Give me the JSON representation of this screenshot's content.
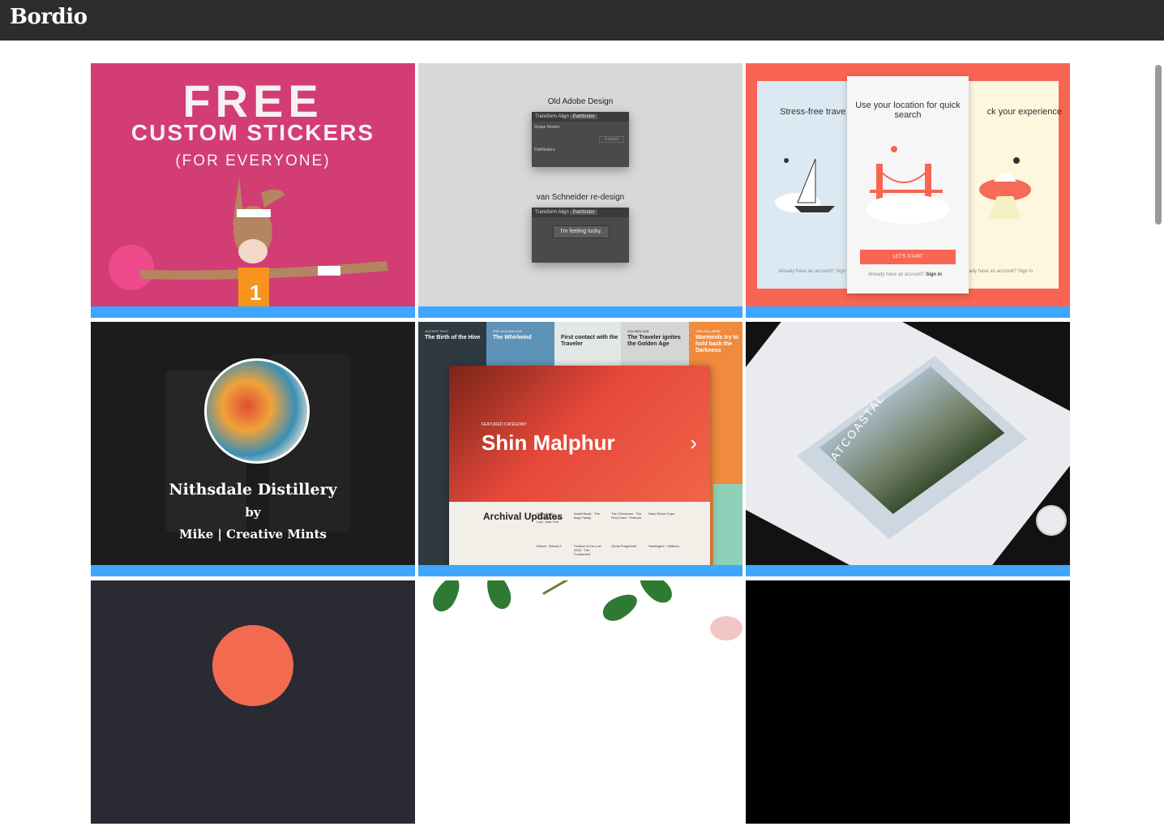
{
  "app": {
    "logo": "Bordio"
  },
  "cards": [
    {
      "name": "stickers",
      "line1": "FREE",
      "line2": "CUSTOM STICKERS",
      "line3": "(FOR EVERYONE)",
      "jersey": "1"
    },
    {
      "name": "pathfinder",
      "title_old": "Old Adobe Design",
      "title_new": "van Schneider re-design",
      "tabs": [
        "Transform",
        "Align",
        "Pathfinder"
      ],
      "shape_modes": "Shape Modes:",
      "pathfinders": "Pathfinders:",
      "expand": "Expand",
      "lucky": "I'm feeling lucky."
    },
    {
      "name": "location-app",
      "left_text": "Stress-free trave",
      "center_text": "Use your location for quick search",
      "right_text": "ck your experience",
      "cta": "LET'S START",
      "account": "Already have an account?",
      "signin": "Sign in",
      "account_left": "Already have an account? Sign",
      "account_right": "ready have an account? Sign in"
    },
    {
      "name": "distillery",
      "title": "Nithsdale Distillery",
      "by": "by",
      "author": "Mike | Creative Mints"
    },
    {
      "name": "shin-malphur",
      "hero_title": "Shin Malphur",
      "featured": "FEATURED CATEGORY",
      "archival": "Archival Updates",
      "strips": [
        {
          "kicker": "ANCIENT PAST",
          "title": "The Birth of the Hive"
        },
        {
          "kicker": "PRE-GOLDEN AGE",
          "title": "The Whirlwind"
        },
        {
          "kicker": "",
          "title": "First contact with the Traveler"
        },
        {
          "kicker": "GOLDEN AGE",
          "title": "The Traveler ignites the Golden Age"
        },
        {
          "kicker": "THE COLLAPSE",
          "title": "Warminds try to hold back the Darkness"
        }
      ],
      "columns": [
        "Omar Agah · Ahamkara · Alpha Lupi · Aws One",
        "Andal Brask · The Bray Family",
        "The Crimsonus · The First Crota · Firebore",
        "Deep Stone Crypt",
        "Elikoni · Eriana-3",
        "Festival of the Lost 2016 · The Fundament",
        "Ghost Fragments",
        "Harbingers · Hellborn"
      ],
      "side_text": "A Hunte · The Last W · information · Shin Malph"
    },
    {
      "name": "iphone-atcoastal",
      "label": "ATCOASTAL"
    },
    {
      "name": "dark-orange",
      "label": ""
    },
    {
      "name": "leaves",
      "label": ""
    },
    {
      "name": "black",
      "label": ""
    }
  ],
  "colors": {
    "topbar": "#2d2c2f",
    "accent_bar": "#3ea6ff",
    "sticker_bg": "#d23d74",
    "coral": "#f86552"
  }
}
